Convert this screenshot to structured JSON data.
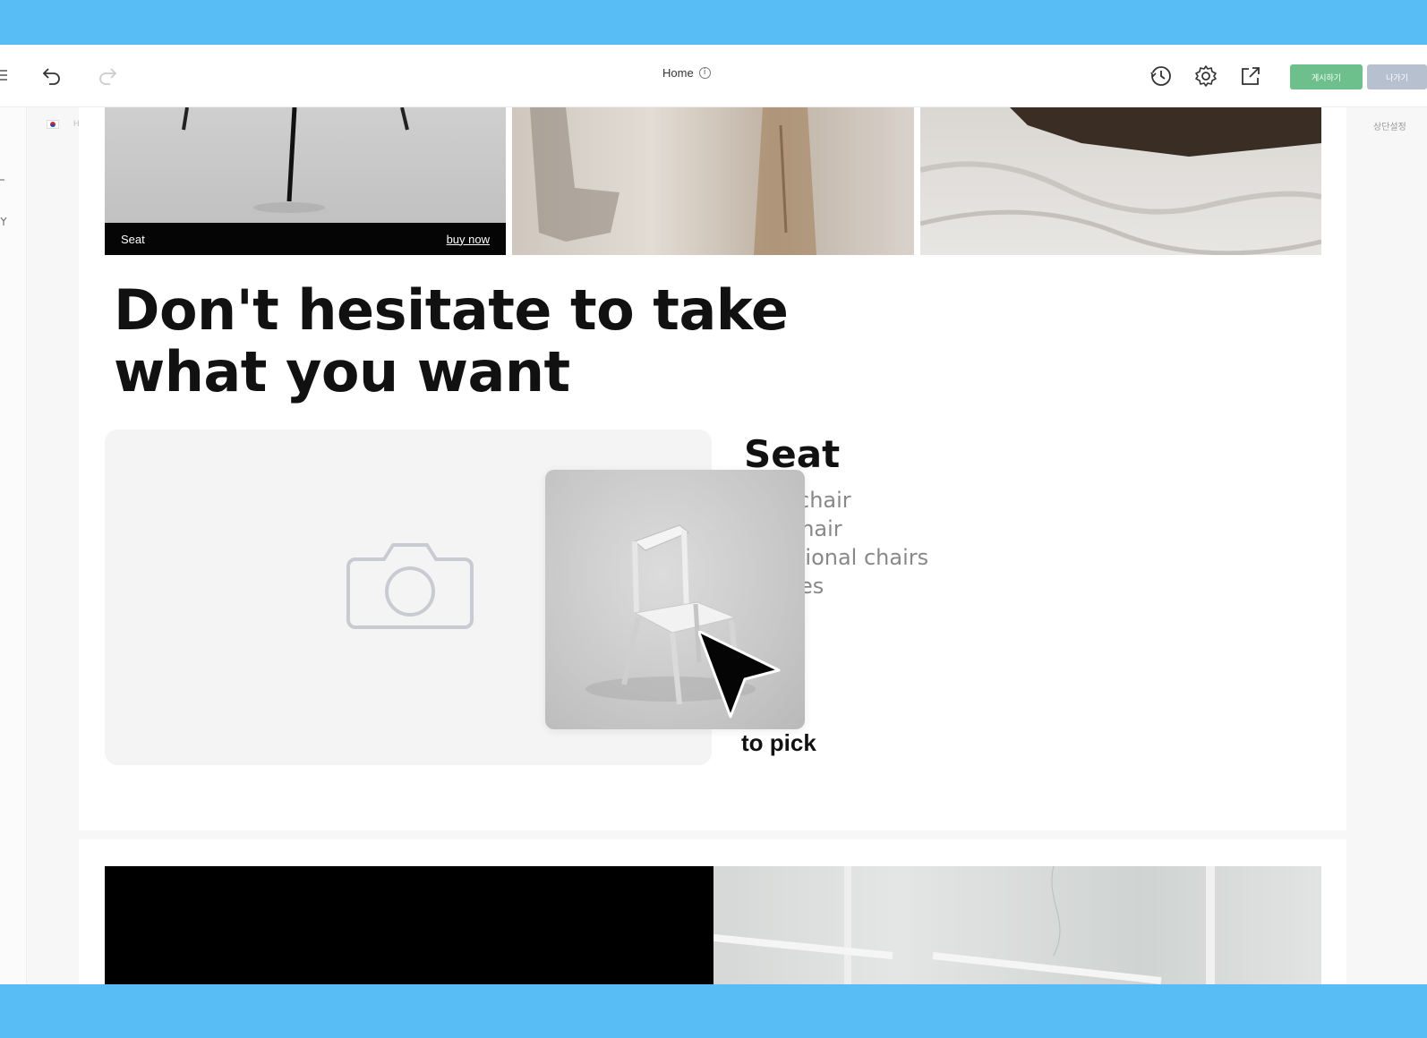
{
  "toolbar": {
    "page_title": "Home",
    "publish_label": "게시하기",
    "exit_label": "나가기"
  },
  "sidebar": {
    "locale_label": "H"
  },
  "right_panel": {
    "label": "상단설정"
  },
  "gallery": {
    "caption_title": "Seat",
    "caption_link": "buy now"
  },
  "headline": {
    "line1": "Don't hesitate to take",
    "line2": "what you want"
  },
  "product": {
    "title": "Seat",
    "items": [
      "chair",
      "chair",
      "tional chairs",
      "es"
    ],
    "pick_label": "to pick"
  },
  "icons": {
    "menu": "hamburger-icon",
    "undo": "undo-icon",
    "redo": "redo-icon",
    "info": "info-icon",
    "history": "history-icon",
    "settings": "gear-icon",
    "preview": "external-link-icon",
    "camera": "camera-icon",
    "cursor": "mouse-pointer-icon"
  },
  "colors": {
    "frame": "#58bcf5",
    "publish": "#6dc08b",
    "exit": "#b7c0cf"
  }
}
